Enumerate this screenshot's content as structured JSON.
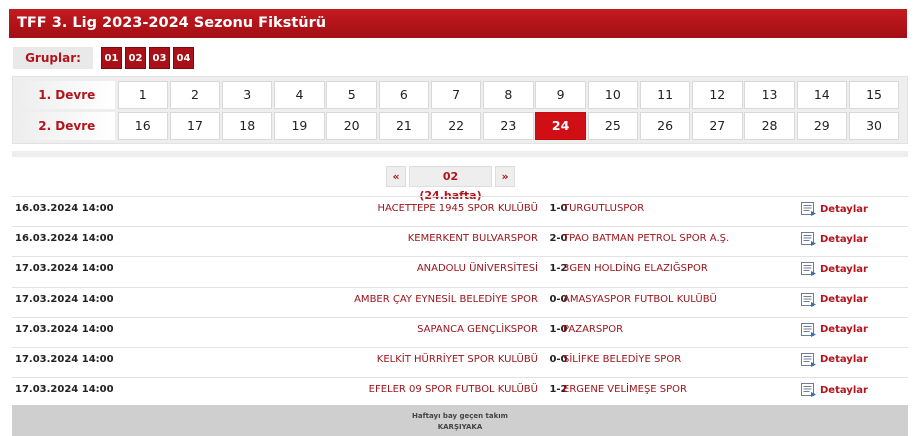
{
  "header": {
    "title": "TFF 3. Lig 2023-2024 Sezonu Fikstürü"
  },
  "groups": {
    "label": "Gruplar:",
    "items": [
      "01",
      "02",
      "03",
      "04"
    ]
  },
  "weeks": {
    "row1_label": "1. Devre",
    "row2_label": "2. Devre",
    "row1": [
      "1",
      "2",
      "3",
      "4",
      "5",
      "6",
      "7",
      "8",
      "9",
      "10",
      "11",
      "12",
      "13",
      "14",
      "15"
    ],
    "row2": [
      "16",
      "17",
      "18",
      "19",
      "20",
      "21",
      "22",
      "23",
      "24",
      "25",
      "26",
      "27",
      "28",
      "29",
      "30"
    ],
    "active": "24"
  },
  "pager": {
    "prev": "«",
    "current": "02 (24.hafta)",
    "next": "»"
  },
  "matches": [
    {
      "date": "16.03.2024 14:00",
      "home": "HACETTEPE 1945 SPOR KULÜBÜ",
      "score": "1-0",
      "away": "TURGUTLUSPOR",
      "details": "Detaylar"
    },
    {
      "date": "16.03.2024 14:00",
      "home": "KEMERKENT BULVARSPOR",
      "score": "2-0",
      "away": "TPAO BATMAN PETROL SPOR A.Ş.",
      "details": "Detaylar"
    },
    {
      "date": "17.03.2024 14:00",
      "home": "ANADOLU ÜNİVERSİTESİ",
      "score": "1-2",
      "away": "3GEN HOLDİNG ELAZIĞSPOR",
      "details": "Detaylar"
    },
    {
      "date": "17.03.2024 14:00",
      "home": "AMBER ÇAY EYNESİL BELEDİYE SPOR",
      "score": "0-0",
      "away": "AMASYASPOR FUTBOL KULÜBÜ",
      "details": "Detaylar"
    },
    {
      "date": "17.03.2024 14:00",
      "home": "SAPANCA GENÇLİKSPOR",
      "score": "1-0",
      "away": "PAZARSPOR",
      "details": "Detaylar"
    },
    {
      "date": "17.03.2024 14:00",
      "home": "KELKİT HÜRRİYET SPOR KULÜBÜ",
      "score": "0-0",
      "away": "SİLİFKE BELEDİYE SPOR",
      "details": "Detaylar"
    },
    {
      "date": "17.03.2024 14:00",
      "home": "EFELER 09 SPOR FUTBOL KULÜBÜ",
      "score": "1-2",
      "away": "ERGENE VELİMEŞE SPOR",
      "details": "Detaylar"
    }
  ],
  "bay": {
    "label": "Haftayı bay geçen takım",
    "team": "KARŞIYAKA"
  }
}
